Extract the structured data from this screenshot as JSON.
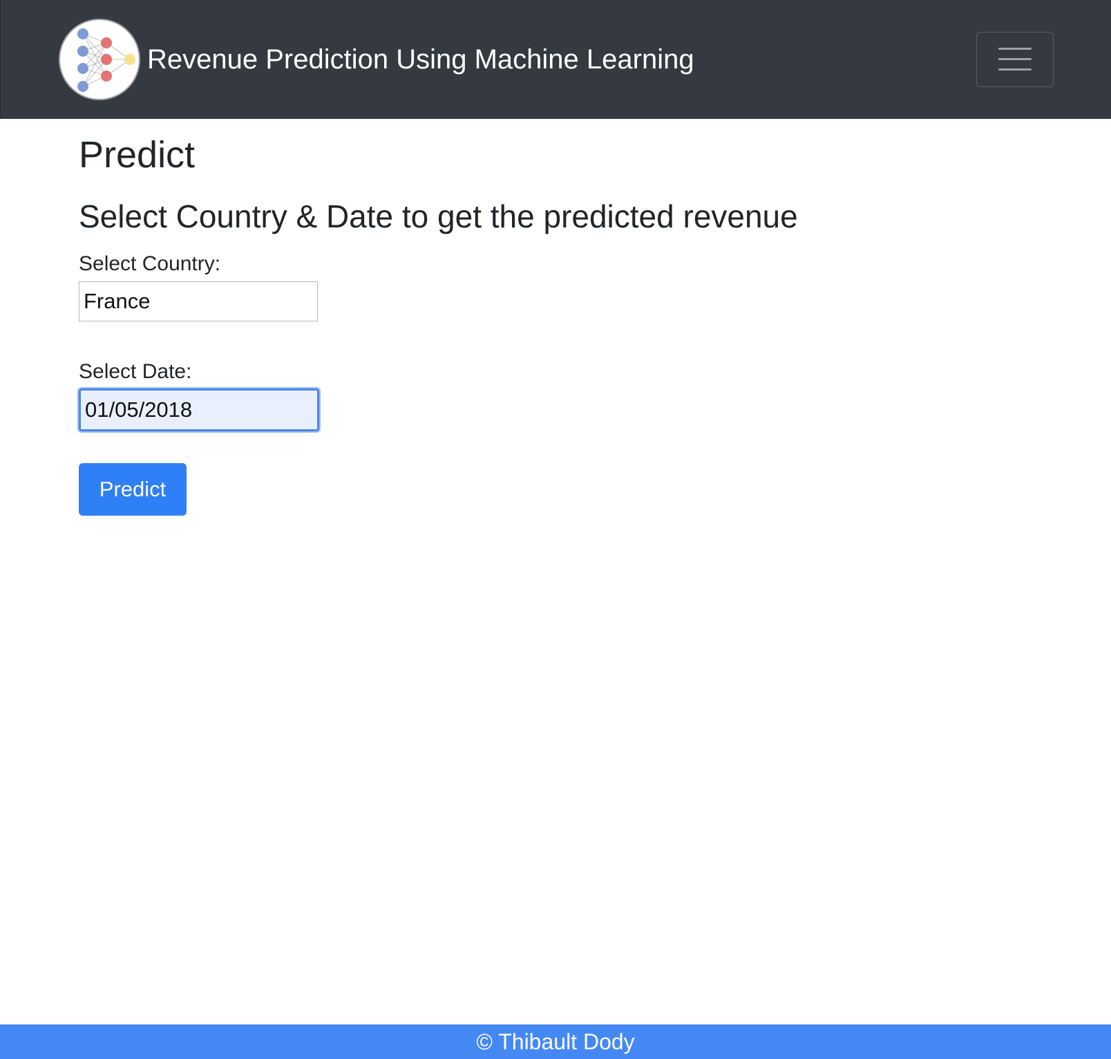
{
  "navbar": {
    "title": "Revenue Prediction Using Machine Learning",
    "logo_icon": "neural-network-icon",
    "menu_icon": "hamburger-menu-icon",
    "background": "#343a40"
  },
  "main": {
    "page_title": "Predict",
    "subtitle": "Select Country & Date to get the predicted revenue",
    "country": {
      "label": "Select Country:",
      "value": "France"
    },
    "date": {
      "label": "Select Date:",
      "value": "01/05/2018"
    },
    "predict_button": {
      "label": "Predict",
      "color": "#2f7ff7"
    }
  },
  "footer": {
    "text": "© Thibault Dody",
    "color": "#4488f4"
  }
}
